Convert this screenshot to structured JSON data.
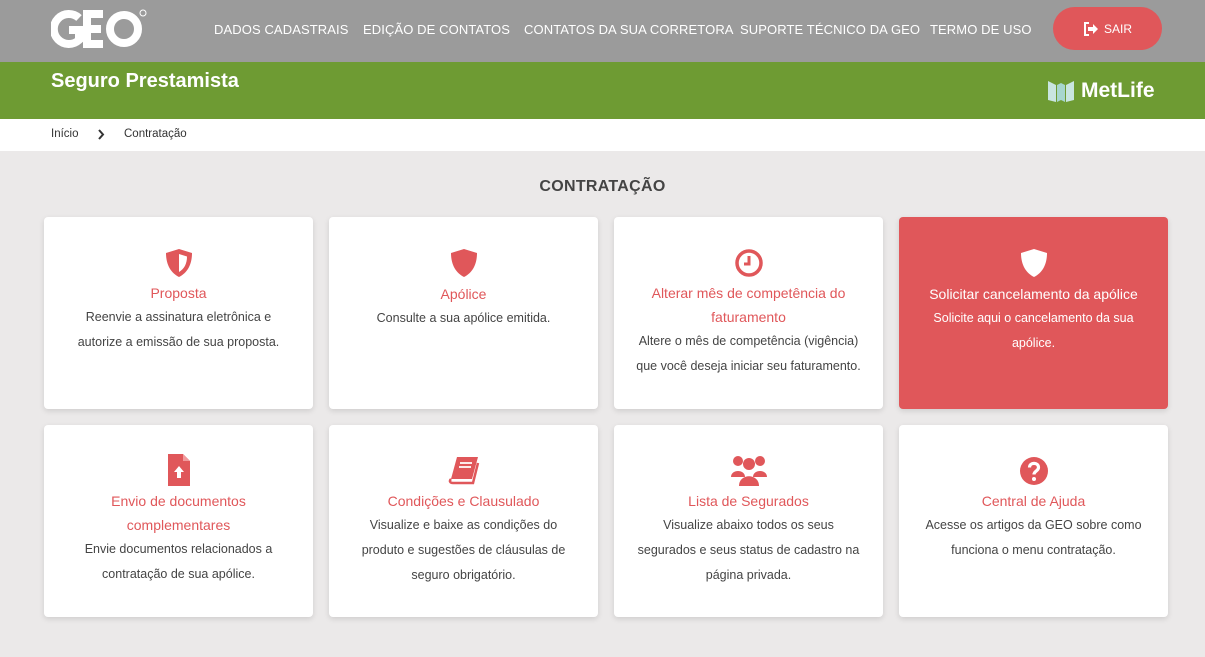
{
  "header": {
    "logo_text": "GEO",
    "nav": [
      "DADOS CADASTRAIS",
      "EDIÇÃO DE CONTATOS",
      "CONTATOS DA SUA CORRETORA",
      "SUPORTE TÉCNICO DA GEO",
      "TERMO DE USO"
    ],
    "logout_label": "SAIR"
  },
  "banner": {
    "title": "Seguro Prestamista",
    "partner": "MetLife"
  },
  "breadcrumb": [
    "Início",
    "Contratação"
  ],
  "section_title": "CONTRATAÇÃO",
  "cards": [
    {
      "icon": "shield-half-icon",
      "title": "Proposta",
      "desc": "Reenvie a assinatura eletrônica e autorize a emissão de sua proposta."
    },
    {
      "icon": "shield-icon",
      "title": "Apólice",
      "desc": "Consulte a sua apólice emitida."
    },
    {
      "icon": "clock-icon",
      "title": "Alterar mês de competência do faturamento",
      "desc": "Altere o mês de competência (vigência) que você deseja iniciar seu faturamento."
    },
    {
      "icon": "shield-icon",
      "title": "Solicitar cancelamento da apólice",
      "desc": "Solicite aqui o cancelamento da sua apólice."
    },
    {
      "icon": "file-upload-icon",
      "title": "Envio de documentos complementares",
      "desc": "Envie documentos relacionados a contratação de sua apólice."
    },
    {
      "icon": "book-icon",
      "title": "Condições e Clausulado",
      "desc": "Visualize e baixe as condições do produto e sugestões de cláusulas de seguro obrigatório."
    },
    {
      "icon": "users-icon",
      "title": "Lista de Segurados",
      "desc": "Visualize abaixo todos os seus segurados e seus status de cadastro na página privada."
    },
    {
      "icon": "question-circle-icon",
      "title": "Central de Ajuda",
      "desc": "Acesse os artigos da GEO sobre como funciona o menu contratação."
    }
  ],
  "colors": {
    "accent": "#e0575a",
    "green": "#6e9b33",
    "topbar": "#9b9b9b"
  }
}
